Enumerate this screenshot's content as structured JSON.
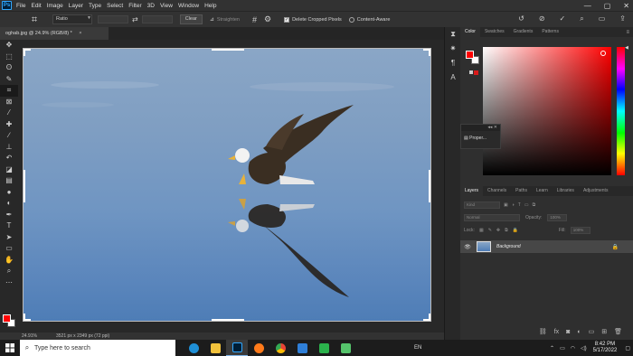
{
  "app": {
    "logo": "Ps"
  },
  "menu": [
    "File",
    "Edit",
    "Image",
    "Layer",
    "Type",
    "Select",
    "Filter",
    "3D",
    "View",
    "Window",
    "Help"
  ],
  "window_controls": {
    "minimize": "—",
    "maximize": "▢",
    "close": "✕"
  },
  "options_bar": {
    "ratio_value": "Ratio",
    "clear_label": "Clear",
    "straighten_label": "Straighten",
    "delete_cropped_label": "Delete Cropped Pixels",
    "delete_cropped_checked": true,
    "content_aware_label": "Content-Aware",
    "content_aware_checked": false
  },
  "document": {
    "tab_title": "oghab.jpg @ 24.9% (RGB/8) *",
    "close_glyph": "×"
  },
  "status": {
    "zoom": "24.91%",
    "dimensions": "3521 px x 2349 px (72 ppi)"
  },
  "tools": [
    "move-icon",
    "marquee-icon",
    "lasso-icon",
    "quick-select-icon",
    "crop-icon",
    "frame-icon",
    "eyedropper-icon",
    "healing-icon",
    "brush-icon",
    "stamp-icon",
    "history-brush-icon",
    "eraser-icon",
    "gradient-icon",
    "blur-icon",
    "dodge-icon",
    "pen-icon",
    "type-icon",
    "path-select-icon",
    "shape-icon",
    "hand-icon",
    "zoom-icon",
    "more-tools-icon"
  ],
  "colors": {
    "foreground": "#ff0000",
    "background": "#ffffff"
  },
  "properties_float": {
    "title": "Proper..."
  },
  "panels": {
    "color_tabs": [
      "Color",
      "Swatches",
      "Gradients",
      "Patterns"
    ],
    "layers_tabs": [
      "Layers",
      "Channels",
      "Paths",
      "Learn",
      "Libraries",
      "Adjustments"
    ],
    "search_kind": "Kind",
    "blend_mode": "Normal",
    "opacity_label": "Opacity:",
    "opacity_value": "100%",
    "lock_label": "Lock:",
    "fill_label": "Fill:",
    "fill_value": "100%",
    "layer_name": "Background"
  },
  "taskbar": {
    "search_placeholder": "Type here to search",
    "language": "EN",
    "time": "8:42 PM",
    "date": "5/17/2022",
    "apps": [
      {
        "name": "edge",
        "color": "#1f8fd6"
      },
      {
        "name": "file-explorer",
        "color": "#f2c23c"
      },
      {
        "name": "photoshop",
        "color": "#31a8ff"
      },
      {
        "name": "firefox",
        "color": "#ff7a1a"
      },
      {
        "name": "chrome",
        "color": "#3ab54a"
      },
      {
        "name": "app-blue",
        "color": "#2f7fd8"
      },
      {
        "name": "app-green",
        "color": "#2bb24c"
      },
      {
        "name": "app-green-2",
        "color": "#55c36b"
      }
    ]
  }
}
